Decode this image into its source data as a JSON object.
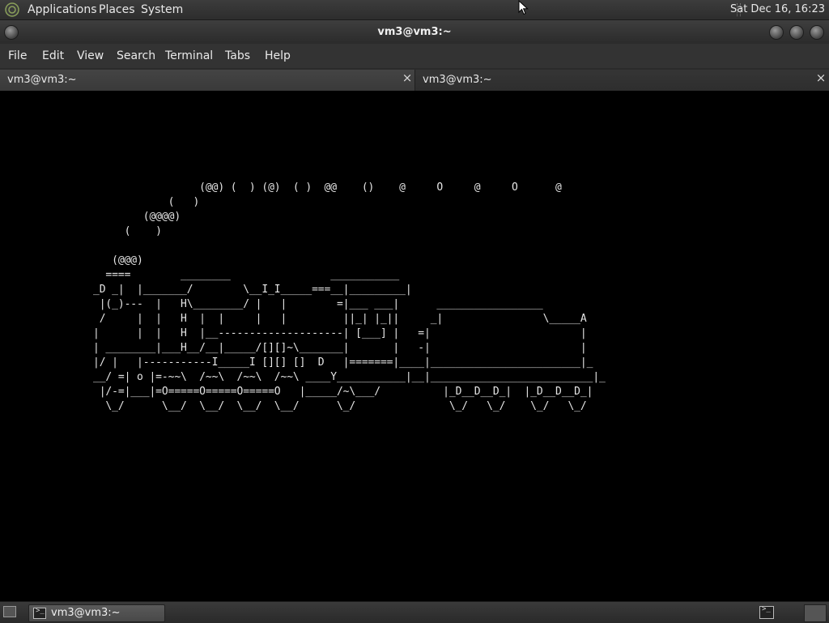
{
  "top_panel": {
    "menus": [
      "Applications",
      "Places",
      "System"
    ],
    "clock": "Sat Dec 16, 16:23"
  },
  "window": {
    "title": "vm3@vm3:~",
    "menu": [
      "File",
      "Edit",
      "View",
      "Search",
      "Terminal",
      "Tabs",
      "Help"
    ],
    "tabs": [
      {
        "label": "vm3@vm3:~",
        "close": "×"
      },
      {
        "label": "vm3@vm3:~",
        "close": "×"
      }
    ]
  },
  "terminal": {
    "output": "                 (@@) (  ) (@)  ( )  @@    ()    @     O     @     O      @\n            (   )\n        (@@@@)\n     (    )\n\n   (@@@)\n  ====        ________                ___________\n_D _|  |_______/        \\__I_I_____===__|_________|\n |(_)---  |   H\\________/ |   |        =|___ ___|      _________________\n /     |  |   H  |  |     |   |         ||_| |_||     _|                \\_____A\n|      |  |   H  |__--------------------| [___] |   =|                        |\n| ________|___H__/__|_____/[][]~\\_______|       |   -|                        |\n|/ |   |-----------I_____I [][] []  D   |=======|____|________________________|_\n__/ =| o |=-~~\\  /~~\\  /~~\\  /~~\\ ____Y___________|__|__________________________|_\n |/-=|___|=O=====O=====O=====O   |_____/~\\___/          |_D__D__D_|  |_D__D__D_|\n  \\_/      \\__/  \\__/  \\__/  \\__/      \\_/               \\_/   \\_/    \\_/   \\_/"
  },
  "taskbar": {
    "task_label": "vm3@vm3:~"
  }
}
